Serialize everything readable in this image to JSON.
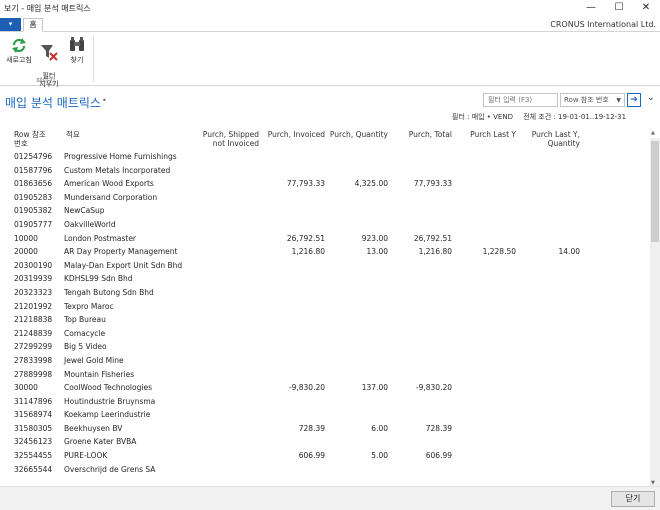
{
  "window": {
    "title": "보기 - 매입 분석 매트릭스",
    "minimize": "—",
    "maximize": "☐",
    "close": "✕"
  },
  "ribbon": {
    "app_menu_icon": "▾",
    "home_tab": "홈",
    "company": "CRONUS International Ltd.",
    "refresh_label": "새로고침",
    "clear_filter_label": "필터\n지우기",
    "find_label": "찾기",
    "group_label": "페이지"
  },
  "page": {
    "title": "매입 분석 매트릭스",
    "title_dot": "•",
    "filter_placeholder": "필터 입력 (F3)",
    "field_select": "Row 참조 번호",
    "filter_text": "필터 : 매입 • VEND",
    "total_condition": "전체 조건 : 19-01-01..19-12-31"
  },
  "columns": {
    "no": "Row 참조\n번호",
    "name": "적요",
    "pis": "Purch, Shipped\nnot Invoiced",
    "pi": "Purch, Invoiced",
    "pq": "Purch, Quantity",
    "pt": "Purch, Total",
    "ply": "Purch Last Y",
    "plyq": "Purch Last Y,\nQuantity"
  },
  "rows": [
    {
      "no": "01254796",
      "name": "Progressive Home Furnishings",
      "pis": "",
      "pi": "",
      "pq": "",
      "pt": "",
      "ply": "",
      "plyq": ""
    },
    {
      "no": "01587796",
      "name": "Custom Metals Incorporated",
      "pis": "",
      "pi": "",
      "pq": "",
      "pt": "",
      "ply": "",
      "plyq": ""
    },
    {
      "no": "01863656",
      "name": "American Wood Exports",
      "pis": "",
      "pi": "77,793.33",
      "pq": "4,325.00",
      "pt": "77,793.33",
      "ply": "",
      "plyq": ""
    },
    {
      "no": "01905283",
      "name": "Mundersand Corporation",
      "pis": "",
      "pi": "",
      "pq": "",
      "pt": "",
      "ply": "",
      "plyq": ""
    },
    {
      "no": "01905382",
      "name": "NewCaSup",
      "pis": "",
      "pi": "",
      "pq": "",
      "pt": "",
      "ply": "",
      "plyq": ""
    },
    {
      "no": "01905777",
      "name": "OakvilleWorld",
      "pis": "",
      "pi": "",
      "pq": "",
      "pt": "",
      "ply": "",
      "plyq": ""
    },
    {
      "no": "10000",
      "name": "London Postmaster",
      "pis": "",
      "pi": "26,792.51",
      "pq": "923.00",
      "pt": "26,792.51",
      "ply": "",
      "plyq": ""
    },
    {
      "no": "20000",
      "name": "AR Day Property Management",
      "pis": "",
      "pi": "1,216.80",
      "pq": "13.00",
      "pt": "1,216.80",
      "ply": "1,228.50",
      "plyq": "14.00"
    },
    {
      "no": "20300190",
      "name": "Malay-Dan Export Unit Sdn Bhd",
      "pis": "",
      "pi": "",
      "pq": "",
      "pt": "",
      "ply": "",
      "plyq": ""
    },
    {
      "no": "20319939",
      "name": "KDHSL99 Sdn Bhd",
      "pis": "",
      "pi": "",
      "pq": "",
      "pt": "",
      "ply": "",
      "plyq": ""
    },
    {
      "no": "20323323",
      "name": "Tengah Butong Sdn Bhd",
      "pis": "",
      "pi": "",
      "pq": "",
      "pt": "",
      "ply": "",
      "plyq": ""
    },
    {
      "no": "21201992",
      "name": "Texpro Maroc",
      "pis": "",
      "pi": "",
      "pq": "",
      "pt": "",
      "ply": "",
      "plyq": ""
    },
    {
      "no": "21218838",
      "name": "Top Bureau",
      "pis": "",
      "pi": "",
      "pq": "",
      "pt": "",
      "ply": "",
      "plyq": ""
    },
    {
      "no": "21248839",
      "name": "Comacycle",
      "pis": "",
      "pi": "",
      "pq": "",
      "pt": "",
      "ply": "",
      "plyq": ""
    },
    {
      "no": "27299299",
      "name": "Big 5 Video",
      "pis": "",
      "pi": "",
      "pq": "",
      "pt": "",
      "ply": "",
      "plyq": ""
    },
    {
      "no": "27833998",
      "name": "Jewel Gold Mine",
      "pis": "",
      "pi": "",
      "pq": "",
      "pt": "",
      "ply": "",
      "plyq": ""
    },
    {
      "no": "27889998",
      "name": "Mountain Fisheries",
      "pis": "",
      "pi": "",
      "pq": "",
      "pt": "",
      "ply": "",
      "plyq": ""
    },
    {
      "no": "30000",
      "name": "CoolWood Technologies",
      "pis": "",
      "pi": "-9,830.20",
      "pq": "137.00",
      "pt": "-9,830.20",
      "ply": "",
      "plyq": ""
    },
    {
      "no": "31147896",
      "name": "Houtindustrie Bruynsma",
      "pis": "",
      "pi": "",
      "pq": "",
      "pt": "",
      "ply": "",
      "plyq": ""
    },
    {
      "no": "31568974",
      "name": "Koekamp Leerindustrie",
      "pis": "",
      "pi": "",
      "pq": "",
      "pt": "",
      "ply": "",
      "plyq": ""
    },
    {
      "no": "31580305",
      "name": "Beekhuysen BV",
      "pis": "",
      "pi": "728.39",
      "pq": "6.00",
      "pt": "728.39",
      "ply": "",
      "plyq": ""
    },
    {
      "no": "32456123",
      "name": "Groene Kater BVBA",
      "pis": "",
      "pi": "",
      "pq": "",
      "pt": "",
      "ply": "",
      "plyq": ""
    },
    {
      "no": "32554455",
      "name": "PURE-LOOK",
      "pis": "",
      "pi": "606.99",
      "pq": "5.00",
      "pt": "606.99",
      "ply": "",
      "plyq": ""
    },
    {
      "no": "32665544",
      "name": "Overschrijd de Grens SA",
      "pis": "",
      "pi": "",
      "pq": "",
      "pt": "",
      "ply": "",
      "plyq": ""
    }
  ],
  "footer": {
    "close_label": "닫기"
  },
  "colors": {
    "accent": "#1a66c3",
    "app_menu": "#1c5fb5"
  }
}
